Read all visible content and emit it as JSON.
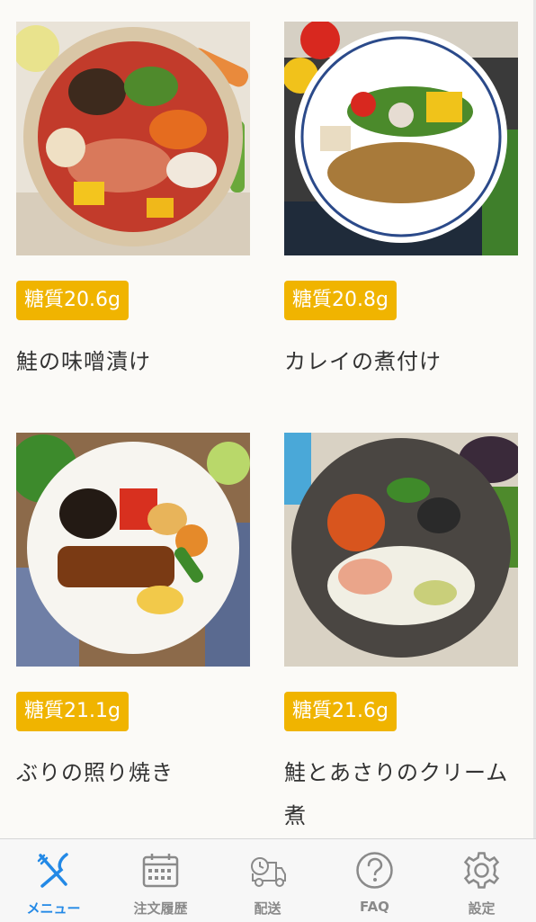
{
  "menu_items": [
    {
      "carb_label": "糖質20.6g",
      "name": "鮭の味噌漬け"
    },
    {
      "carb_label": "糖質20.8g",
      "name": "カレイの煮付け"
    },
    {
      "carb_label": "糖質21.1g",
      "name": "ぶりの照り焼き"
    },
    {
      "carb_label": "糖質21.6g",
      "name": "鮭とあさりのクリーム煮"
    }
  ],
  "tabbar": {
    "menu": "メニュー",
    "history": "注文履歴",
    "delivery": "配送",
    "faq": "FAQ",
    "settings": "設定"
  },
  "colors": {
    "badge": "#f0b400",
    "active_tab": "#2389e6",
    "inactive_tab": "#8a8a8a"
  }
}
